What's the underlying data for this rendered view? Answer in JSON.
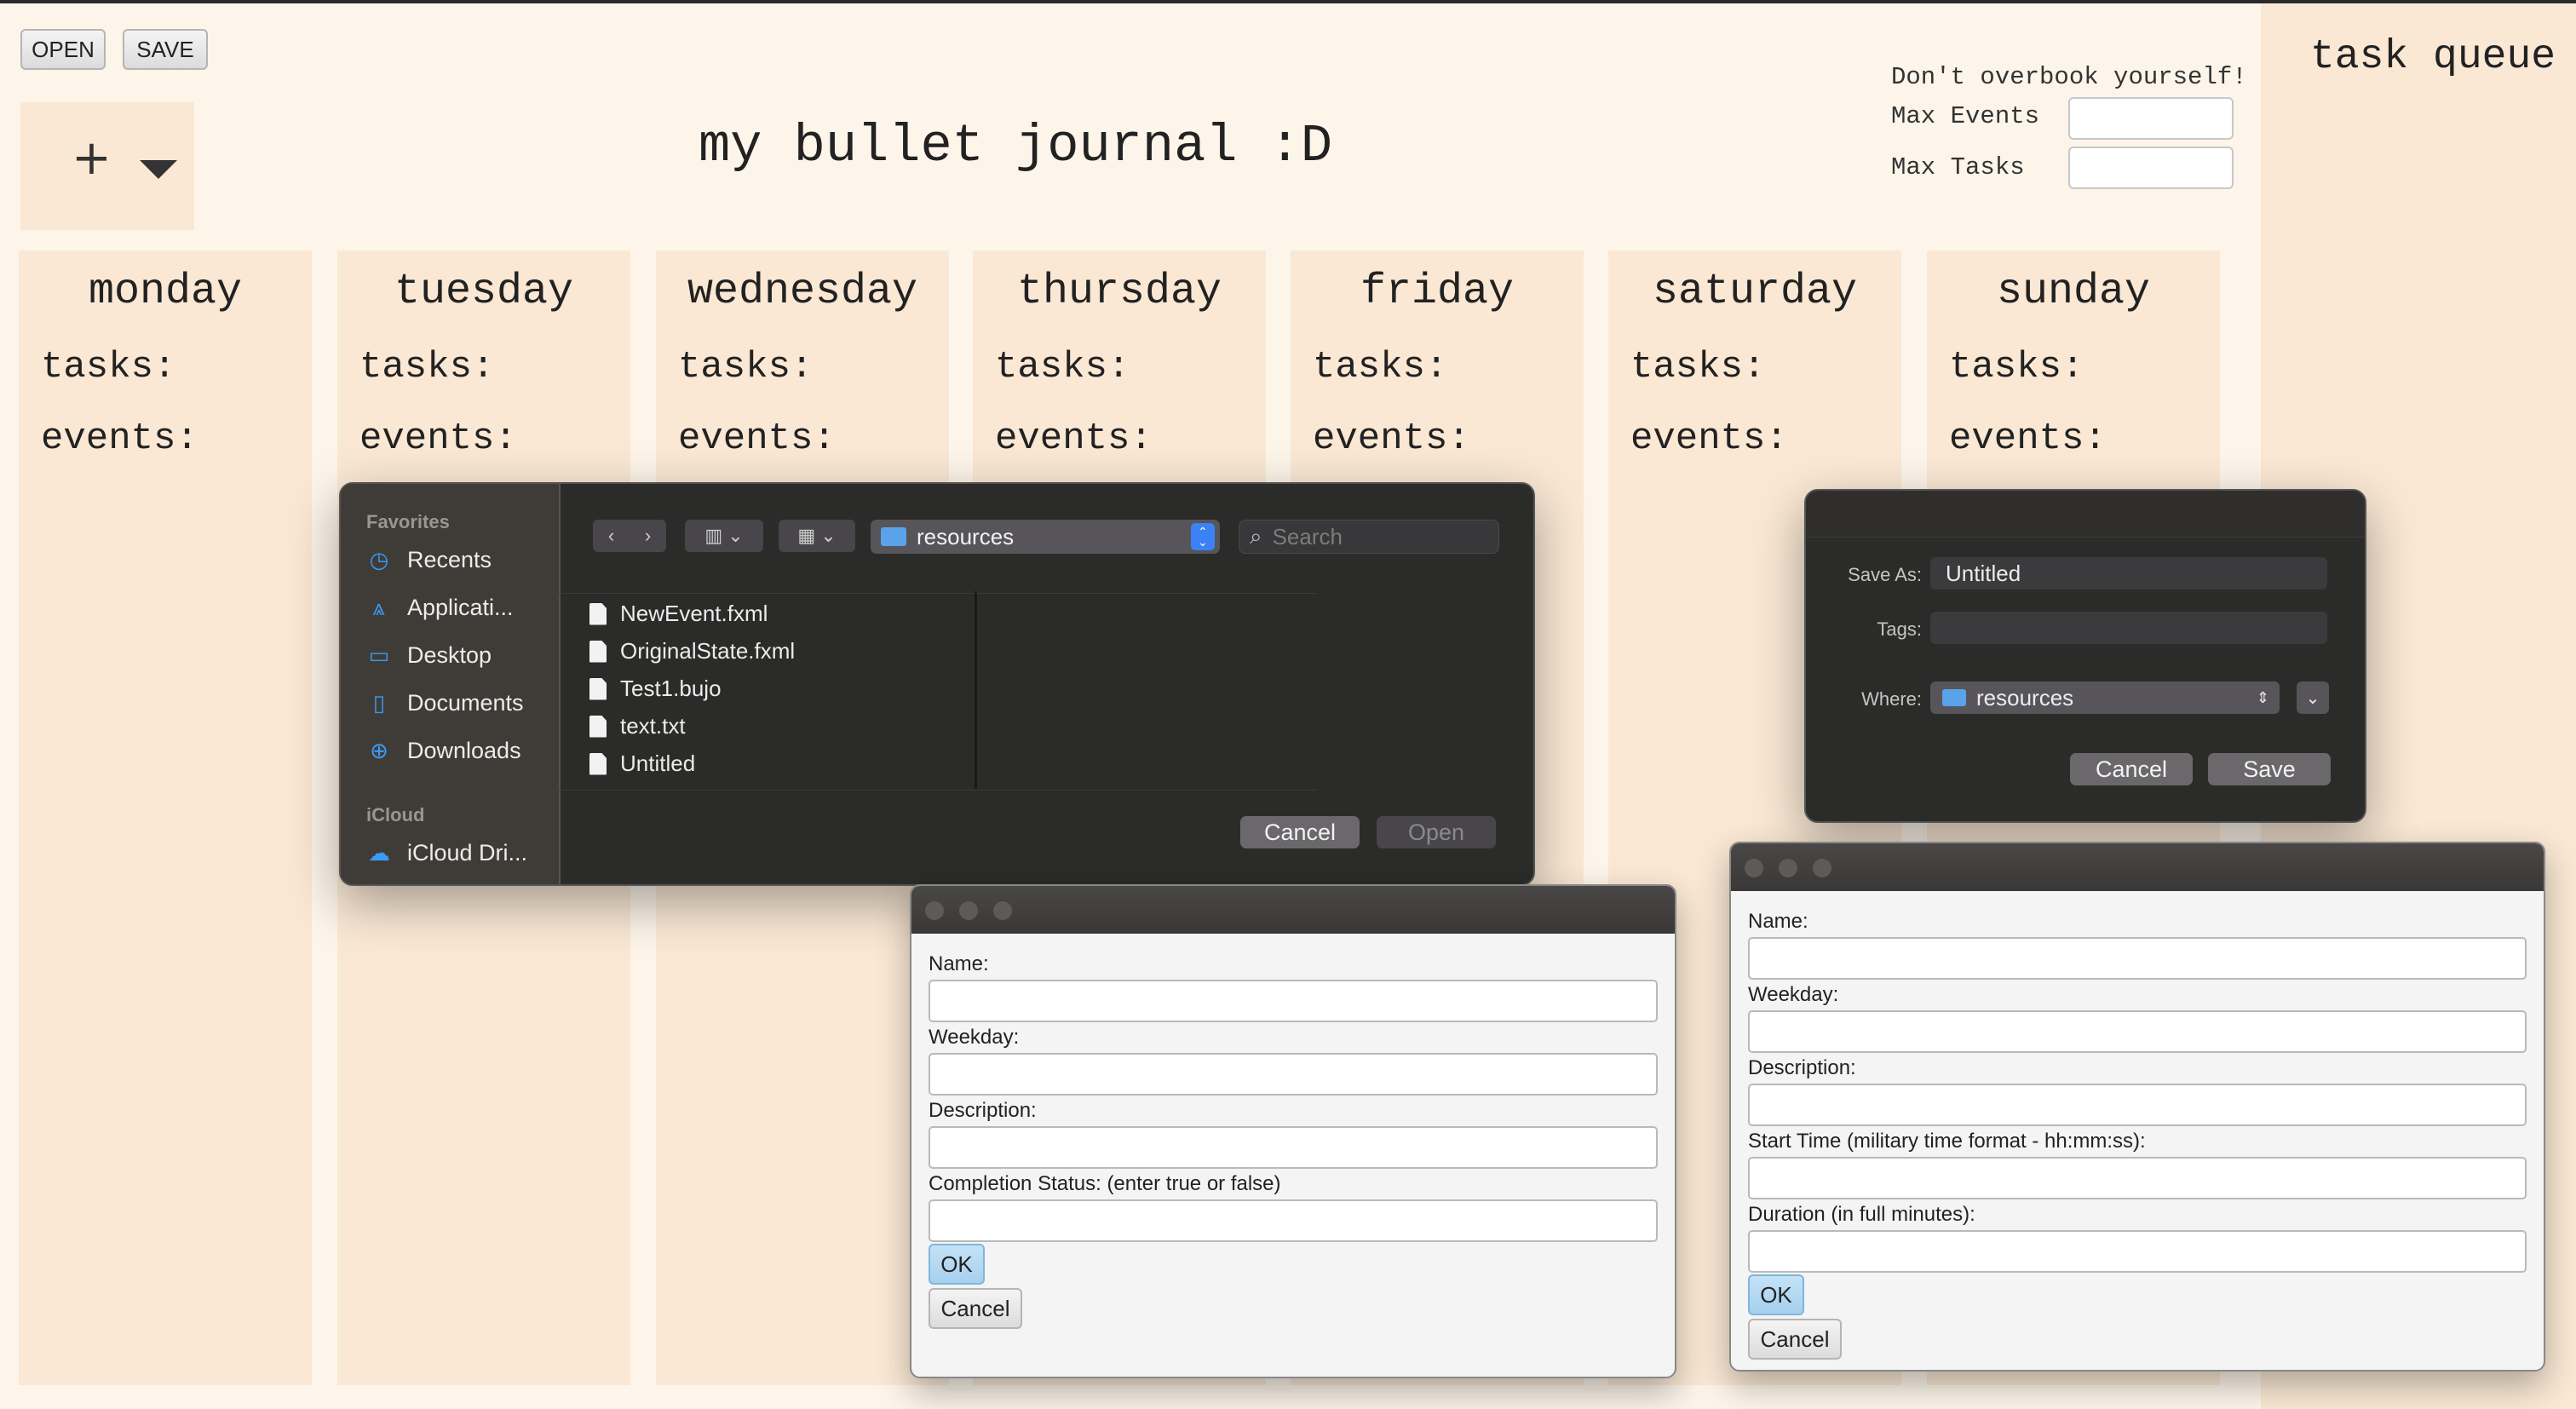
{
  "toolbar": {
    "open_label": "OPEN",
    "save_label": "SAVE"
  },
  "menu": {
    "add_symbol": "+",
    "dropdown_icon": "triangle-down-icon"
  },
  "journal": {
    "title": "my bullet journal :D"
  },
  "limits": {
    "note": "Don't overbook yourself!",
    "max_events_label": "Max Events",
    "max_events_value": "",
    "max_tasks_label": "Max Tasks",
    "max_tasks_value": ""
  },
  "task_queue": {
    "title": "task queue"
  },
  "days": [
    {
      "name": "monday",
      "tasks_label": "tasks:",
      "events_label": "events:"
    },
    {
      "name": "tuesday",
      "tasks_label": "tasks:",
      "events_label": "events:"
    },
    {
      "name": "wednesday",
      "tasks_label": "tasks:",
      "events_label": "events:"
    },
    {
      "name": "thursday",
      "tasks_label": "tasks:",
      "events_label": "events:"
    },
    {
      "name": "friday",
      "tasks_label": "tasks:",
      "events_label": "events:"
    },
    {
      "name": "saturday",
      "tasks_label": "tasks:",
      "events_label": "events:"
    },
    {
      "name": "sunday",
      "tasks_label": "tasks:",
      "events_label": "events:"
    }
  ],
  "open_dialog": {
    "favorites_heading": "Favorites",
    "favorites": [
      {
        "label": "Recents",
        "icon": "clock-icon"
      },
      {
        "label": "Applicati...",
        "icon": "applications-icon"
      },
      {
        "label": "Desktop",
        "icon": "desktop-icon"
      },
      {
        "label": "Documents",
        "icon": "document-icon"
      },
      {
        "label": "Downloads",
        "icon": "download-icon"
      }
    ],
    "icloud_heading": "iCloud",
    "icloud_items": [
      {
        "label": "iCloud Dri...",
        "icon": "cloud-icon"
      }
    ],
    "location": "resources",
    "search_placeholder": "Search",
    "files": [
      "NewEvent.fxml",
      "OriginalState.fxml",
      "Test1.bujo",
      "text.txt",
      "Untitled"
    ],
    "cancel_label": "Cancel",
    "open_label": "Open"
  },
  "save_dialog": {
    "save_as_label": "Save As:",
    "save_as_value": "Untitled",
    "tags_label": "Tags:",
    "tags_value": "",
    "where_label": "Where:",
    "where_value": "resources",
    "cancel_label": "Cancel",
    "save_label": "Save"
  },
  "task_dialog": {
    "name_label": "Name:",
    "weekday_label": "Weekday:",
    "description_label": "Description:",
    "completion_label": "Completion Status: (enter true or false)",
    "ok_label": "OK",
    "cancel_label": "Cancel"
  },
  "event_dialog": {
    "name_label": "Name:",
    "weekday_label": "Weekday:",
    "description_label": "Description:",
    "start_time_label": "Start Time (military time format - hh:mm:ss):",
    "duration_label": "Duration (in full minutes):",
    "ok_label": "OK",
    "cancel_label": "Cancel"
  },
  "colors": {
    "background": "#fdf5e9",
    "column": "#fae8d4",
    "dialog_dark": "#2b2b29",
    "accent_blue": "#3b82f6",
    "ok_button": "#a6d0ee"
  }
}
